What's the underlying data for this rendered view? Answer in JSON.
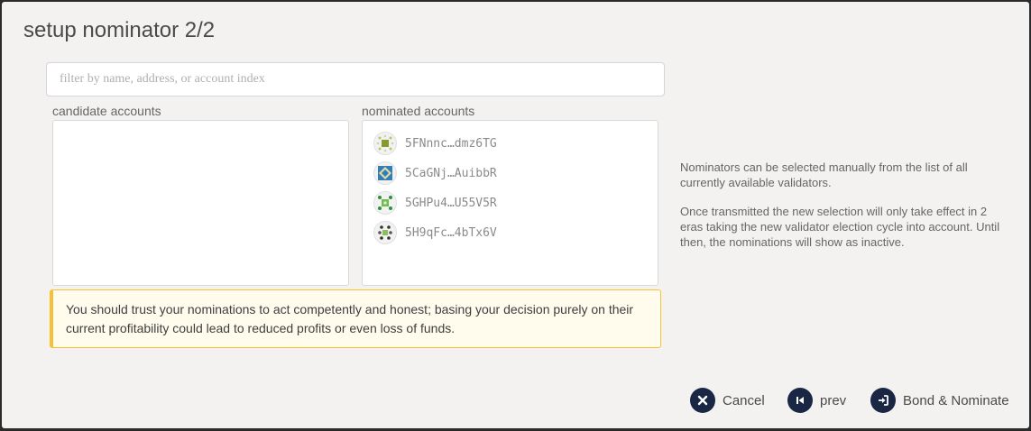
{
  "modal": {
    "title": "setup nominator 2/2"
  },
  "filter": {
    "placeholder": "filter by name, address, or account index",
    "value": ""
  },
  "candidates": {
    "label": "candidate accounts",
    "items": []
  },
  "nominated": {
    "label": "nominated accounts",
    "items": [
      {
        "address": "5FNnnc…dmz6TG",
        "icon": "identicon"
      },
      {
        "address": "5CaGNj…AuibbR",
        "icon": "identicon"
      },
      {
        "address": "5GHPu4…U55V5R",
        "icon": "identicon"
      },
      {
        "address": "5H9qFc…4bTx6V",
        "icon": "identicon"
      }
    ]
  },
  "warning": {
    "text": "You should trust your nominations to act competently and honest; basing your decision purely on their current profitability could lead to reduced profits or even loss of funds."
  },
  "help": {
    "p1": "Nominators can be selected manually from the list of all currently available validators.",
    "p2": "Once transmitted the new selection will only take effect in 2 eras taking the new validator election cycle into account. Until then, the nominations will show as inactive."
  },
  "actions": {
    "cancel": {
      "label": "Cancel",
      "icon": "close-icon"
    },
    "prev": {
      "label": "prev",
      "icon": "step-back-icon"
    },
    "submit": {
      "label": "Bond & Nominate",
      "icon": "sign-in-icon"
    }
  },
  "colors": {
    "accent": "#1a2744",
    "warning_border": "#f5c236"
  }
}
